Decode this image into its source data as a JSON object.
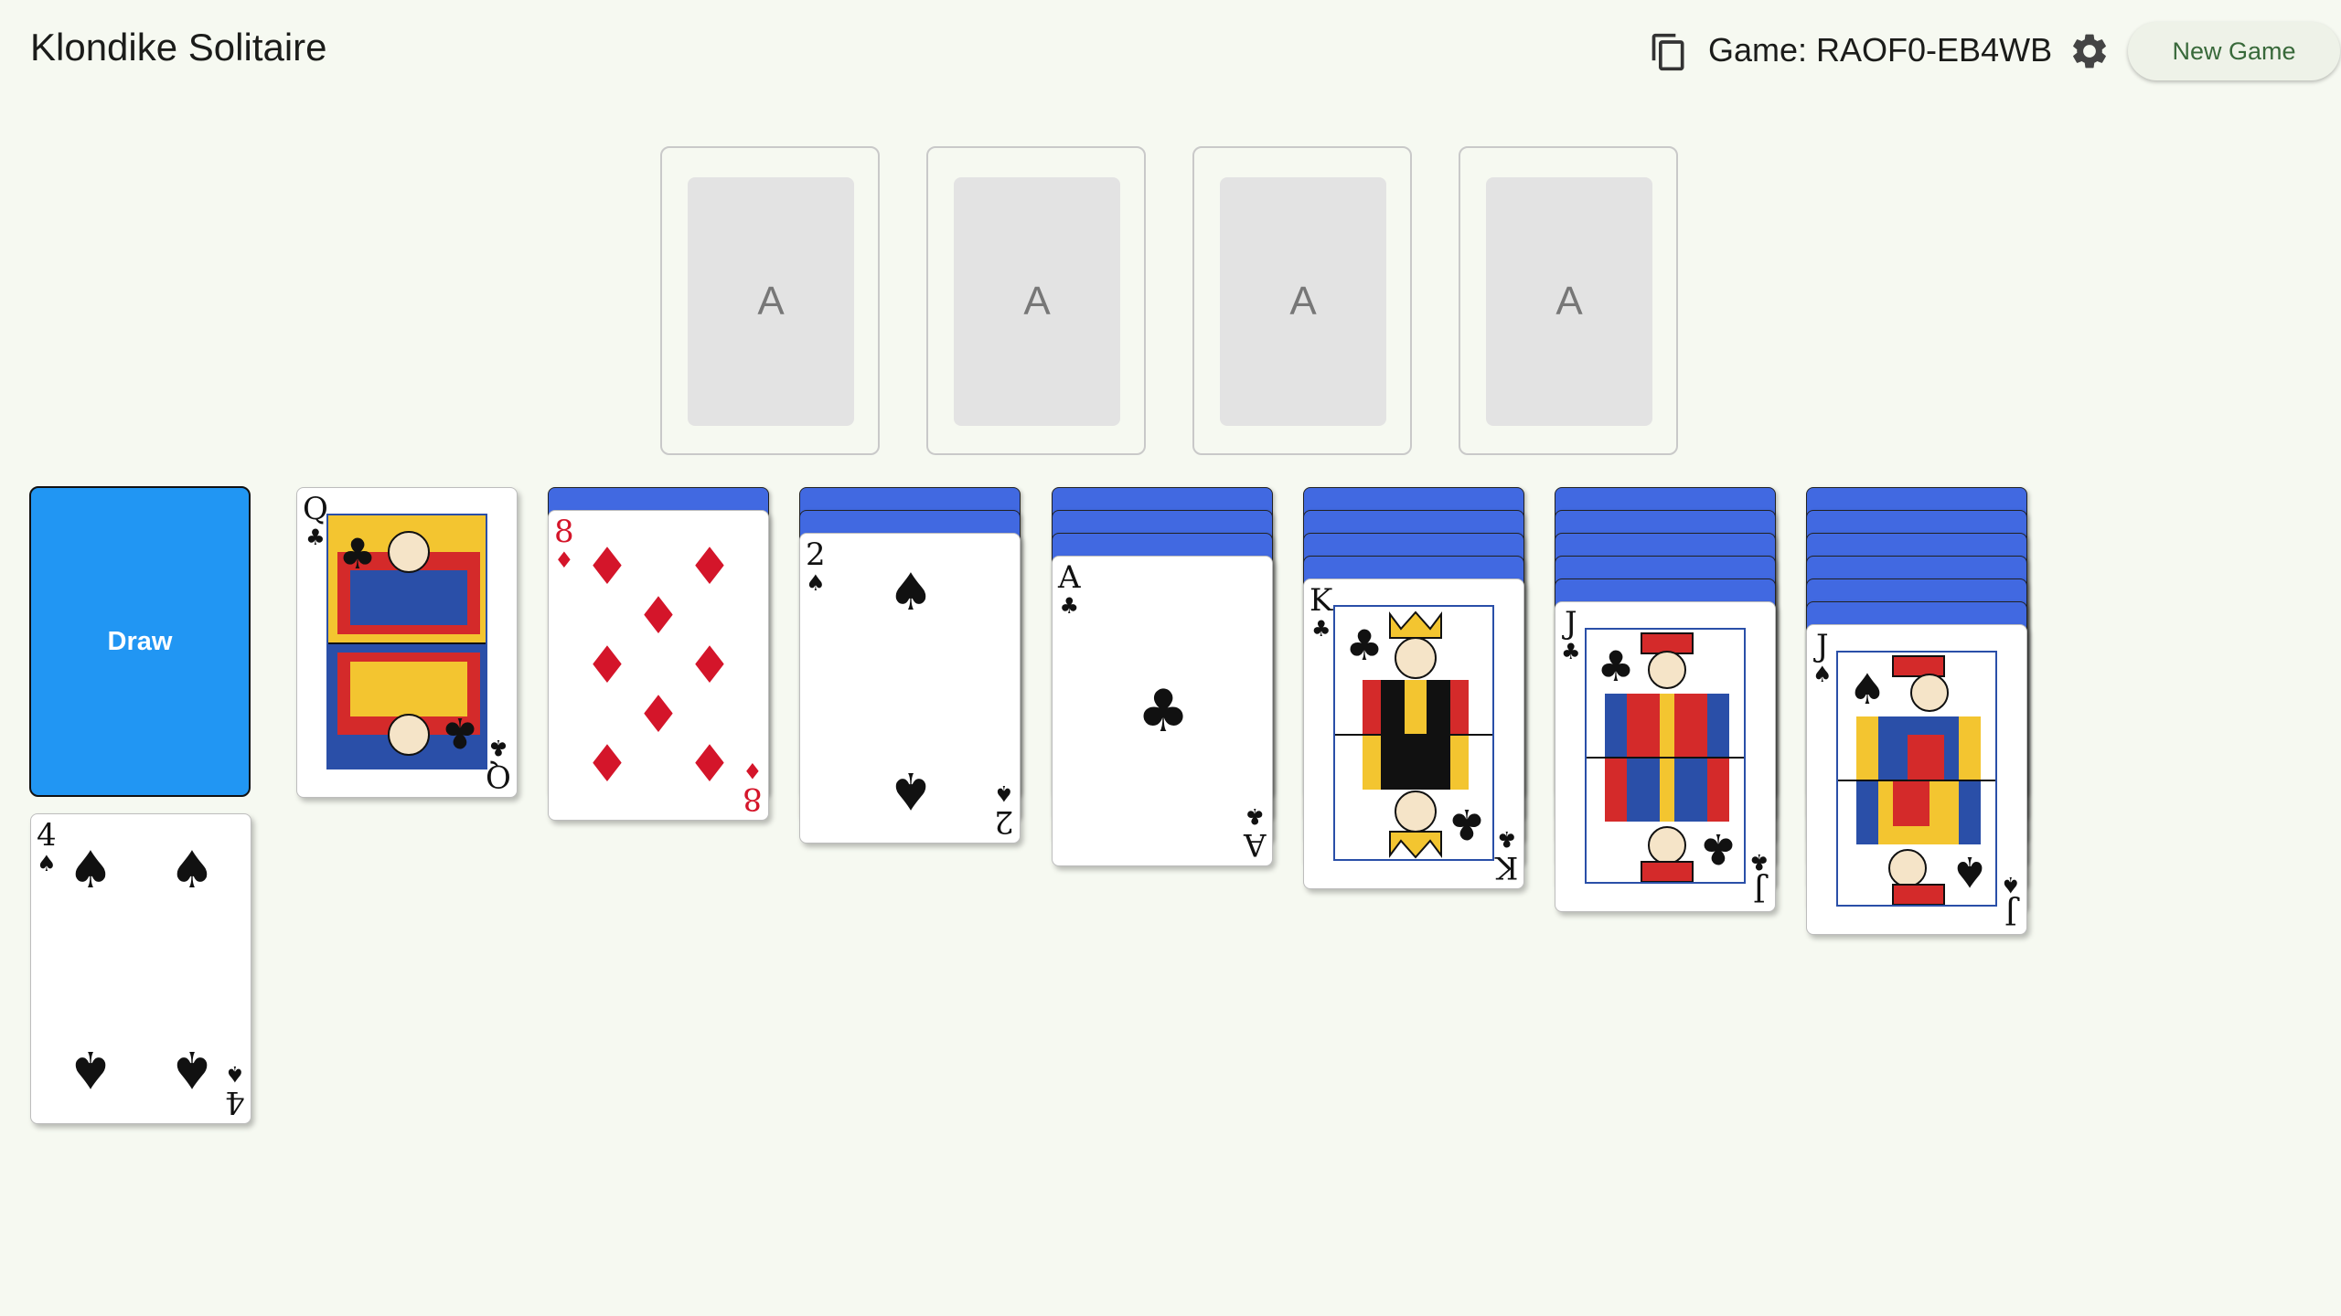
{
  "header": {
    "title": "Klondike Solitaire",
    "game_id": "Game: RAOF0-EB4WB",
    "new_game_label": "New Game",
    "icons": [
      "copy-icon",
      "gear-icon"
    ]
  },
  "foundations": [
    {
      "placeholder": "A"
    },
    {
      "placeholder": "A"
    },
    {
      "placeholder": "A"
    },
    {
      "placeholder": "A"
    }
  ],
  "stock": {
    "label": "Draw"
  },
  "waste": {
    "rank": "4",
    "suit": "♠",
    "color": "black"
  },
  "tableau": [
    {
      "face_down": 0,
      "top": {
        "rank": "Q",
        "suit": "♣",
        "color": "black",
        "face": true
      }
    },
    {
      "face_down": 1,
      "top": {
        "rank": "8",
        "suit": "♦",
        "color": "red"
      }
    },
    {
      "face_down": 2,
      "top": {
        "rank": "2",
        "suit": "♠",
        "color": "black"
      }
    },
    {
      "face_down": 3,
      "top": {
        "rank": "A",
        "suit": "♣",
        "color": "black"
      }
    },
    {
      "face_down": 4,
      "top": {
        "rank": "K",
        "suit": "♣",
        "color": "black",
        "face": true
      }
    },
    {
      "face_down": 5,
      "top": {
        "rank": "J",
        "suit": "♣",
        "color": "black",
        "face": true
      }
    },
    {
      "face_down": 6,
      "top": {
        "rank": "J",
        "suit": "♠",
        "color": "black",
        "face": true
      }
    }
  ],
  "colors": {
    "background": "#f6f9f1",
    "card_back": "#4169e1",
    "stock": "#2196f3",
    "accent_text": "#38693a",
    "red_suit": "#d4152a"
  }
}
